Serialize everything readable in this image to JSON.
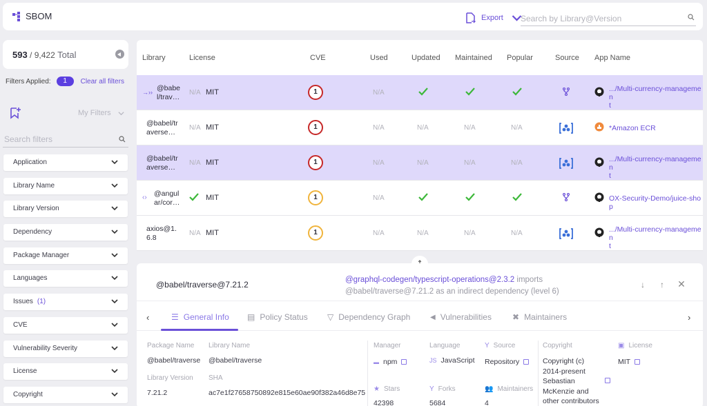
{
  "header": {
    "title": "SBOM",
    "export_label": "Export",
    "search_placeholder": "Search by Library@Version"
  },
  "sidebar": {
    "count_shown": "593",
    "count_total": "/ 9,422",
    "count_suffix": "Total",
    "filters_applied_label": "Filters Applied:",
    "filters_applied_count": "1",
    "clear_all_label": "Clear all filters",
    "my_filters_label": "My Filters",
    "search_placeholder": "Search filters",
    "facets": [
      {
        "label": "Application",
        "count": ""
      },
      {
        "label": "Library Name",
        "count": ""
      },
      {
        "label": "Library Version",
        "count": ""
      },
      {
        "label": "Dependency",
        "count": ""
      },
      {
        "label": "Package Manager",
        "count": ""
      },
      {
        "label": "Languages",
        "count": ""
      },
      {
        "label": "Issues",
        "count": "(1)"
      },
      {
        "label": "CVE",
        "count": ""
      },
      {
        "label": "Vulnerability Severity",
        "count": ""
      },
      {
        "label": "License",
        "count": ""
      },
      {
        "label": "Copyright",
        "count": ""
      }
    ]
  },
  "table": {
    "columns": [
      "Library",
      "License",
      "CVE",
      "Used",
      "Updated",
      "Maintained",
      "Popular",
      "Source",
      "App Name"
    ],
    "rows": [
      {
        "library": "@babel/trav…",
        "lib_line1": "@babe",
        "lib_line2": "l/trav…",
        "lib_icon": "indirect-dependency-icon",
        "license_ok": "N/A",
        "license": "MIT",
        "cve": "1",
        "cve_severity": "high",
        "used": "N/A",
        "updated": "check",
        "maintained": "check",
        "popular": "check",
        "source": "repository-icon",
        "app_icon": "github-icon",
        "app_line1": ".../Multi-currency-managemen",
        "app_line2": "t",
        "selected": true
      },
      {
        "library": "@babel/traverse…",
        "lib_line1": "@babel/tr",
        "lib_line2": "averse…",
        "lib_icon": "",
        "license_ok": "N/A",
        "license": "MIT",
        "cve": "1",
        "cve_severity": "high",
        "used": "N/A",
        "updated": "N/A",
        "maintained": "N/A",
        "popular": "N/A",
        "source": "container-icon",
        "app_icon": "amazon-ecr-icon",
        "app_line1": "*Amazon ECR",
        "app_line2": "",
        "selected": false
      },
      {
        "library": "@babel/traverse…",
        "lib_line1": "@babel/tr",
        "lib_line2": "averse…",
        "lib_icon": "",
        "license_ok": "N/A",
        "license": "MIT",
        "cve": "1",
        "cve_severity": "high",
        "used": "N/A",
        "updated": "N/A",
        "maintained": "N/A",
        "popular": "N/A",
        "source": "container-icon",
        "app_icon": "github-icon",
        "app_line1": ".../Multi-currency-managemen",
        "app_line2": "t",
        "selected": true
      },
      {
        "library": "@angular/cor…",
        "lib_line1": "@angul",
        "lib_line2": "ar/cor…",
        "lib_icon": "direct-dependency-icon",
        "license_ok": "check",
        "license": "MIT",
        "cve": "1",
        "cve_severity": "medium",
        "used": "N/A",
        "updated": "check",
        "maintained": "check",
        "popular": "check",
        "source": "repository-icon",
        "app_icon": "github-icon",
        "app_line1": "OX-Security-Demo/juice-shop",
        "app_line2": "",
        "selected": false
      },
      {
        "library": "axios@1.6.8",
        "lib_line1": "axios@1.",
        "lib_line2": "6.8",
        "lib_icon": "",
        "license_ok": "N/A",
        "license": "MIT",
        "cve": "1",
        "cve_severity": "medium",
        "used": "N/A",
        "updated": "N/A",
        "maintained": "N/A",
        "popular": "N/A",
        "source": "container-icon",
        "app_icon": "github-icon",
        "app_line1": ".../Multi-currency-managemen",
        "app_line2": "t",
        "selected": false
      }
    ]
  },
  "detail": {
    "title": "@babel/traverse@7.21.2",
    "importer_link": "@graphql-codegen/typescript-operations@2.3.2",
    "imports_word": "imports",
    "imports_line2": "@babel/traverse@7.21.2 as an indirect dependency (level 6)",
    "tabs": [
      {
        "label": "General Info",
        "icon": "list-icon",
        "active": true
      },
      {
        "label": "Policy Status",
        "icon": "policy-icon",
        "active": false
      },
      {
        "label": "Dependency Graph",
        "icon": "graph-icon",
        "active": false
      },
      {
        "label": "Vulnerabilities",
        "icon": "megaphone-icon",
        "active": false
      },
      {
        "label": "Maintainers",
        "icon": "tools-icon",
        "active": false
      }
    ],
    "general": {
      "package_name_label": "Package Name",
      "package_name": "@babel/traverse",
      "library_name_label": "Library Name",
      "library_name": "@babel/traverse",
      "library_version_label": "Library Version",
      "library_version": "7.21.2",
      "sha_label": "SHA",
      "sha": "ac7e1f27658750892e815e60ae90f382a46d8e75",
      "manager_label": "Manager",
      "manager": "npm",
      "language_label": "Language",
      "language_badge": "JS",
      "language": "JavaScript",
      "source_label": "Source",
      "source": "Repository",
      "stars_label": "Stars",
      "stars": "42398",
      "forks_label": "Forks",
      "forks": "5684",
      "maintainers_label": "Maintainers",
      "maintainers": "4",
      "copyright_label": "Copyright",
      "copyright_lines": [
        "Copyright (c)",
        "2014-present",
        "Sebastian",
        "McKenzie and",
        "other contributors"
      ],
      "license_label": "License",
      "license": "MIT"
    }
  },
  "colors": {
    "accent": "#6a4fd8",
    "selected_row": "#dfd9fb",
    "success": "#3db83a",
    "cve_high": "#c62828",
    "cve_medium": "#f0b43c"
  }
}
